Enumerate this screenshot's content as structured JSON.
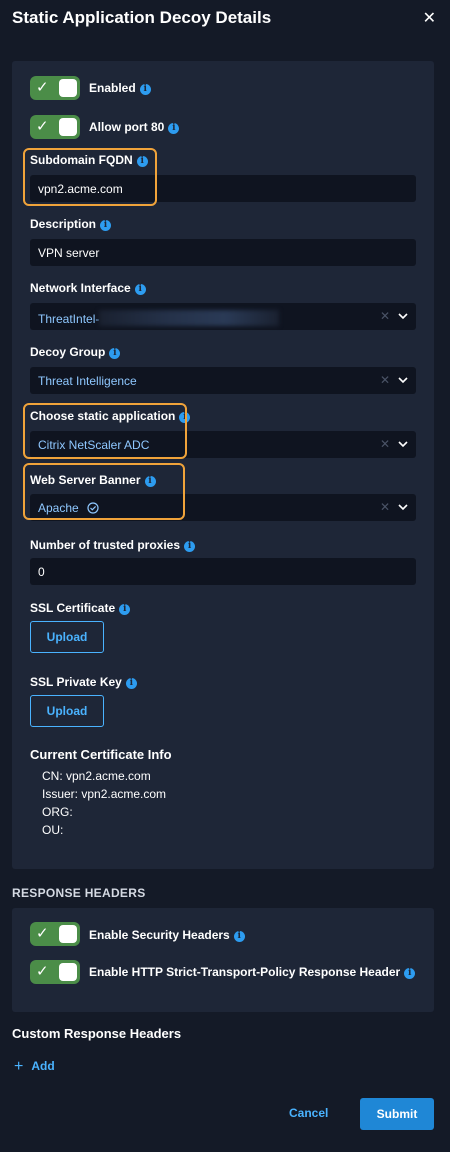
{
  "header": {
    "title": "Static Application Decoy Details",
    "close_icon": "close-icon"
  },
  "toggles": {
    "enabled": {
      "label": "Enabled",
      "on": true
    },
    "allow_port_80": {
      "label": "Allow port 80",
      "on": true
    }
  },
  "fields": {
    "subdomain": {
      "label": "Subdomain FQDN",
      "value": "vpn2.acme.com"
    },
    "description": {
      "label": "Description",
      "value": "VPN server"
    },
    "network_interface": {
      "label": "Network Interface",
      "value": "ThreatIntel-"
    },
    "decoy_group": {
      "label": "Decoy Group",
      "value": "Threat Intelligence"
    },
    "static_application": {
      "label": "Choose static application",
      "value": "Citrix NetScaler ADC"
    },
    "web_server_banner": {
      "label": "Web Server Banner",
      "value": "Apache"
    },
    "trusted_proxies": {
      "label": "Number of trusted proxies",
      "value": "0"
    }
  },
  "ssl": {
    "certificate_label": "SSL Certificate",
    "private_key_label": "SSL Private Key",
    "upload_label": "Upload"
  },
  "certificate_info": {
    "title": "Current Certificate Info",
    "cn": "CN: vpn2.acme.com",
    "issuer": "Issuer: vpn2.acme.com",
    "org": "ORG:",
    "ou": "OU:"
  },
  "response_headers": {
    "section_title": "RESPONSE HEADERS",
    "security_headers_label": "Enable Security Headers",
    "hsts_label": "Enable HTTP Strict-Transport-Policy Response Header"
  },
  "custom_headers": {
    "title": "Custom Response Headers",
    "add_label": "Add"
  },
  "footer": {
    "cancel_label": "Cancel",
    "submit_label": "Submit"
  },
  "colors": {
    "background": "#141a27",
    "panel": "#1e2637",
    "toggle_on": "#4b8d48",
    "accent": "#4ab3ff",
    "highlight": "#f0a33a",
    "submit": "#1f87d6"
  }
}
